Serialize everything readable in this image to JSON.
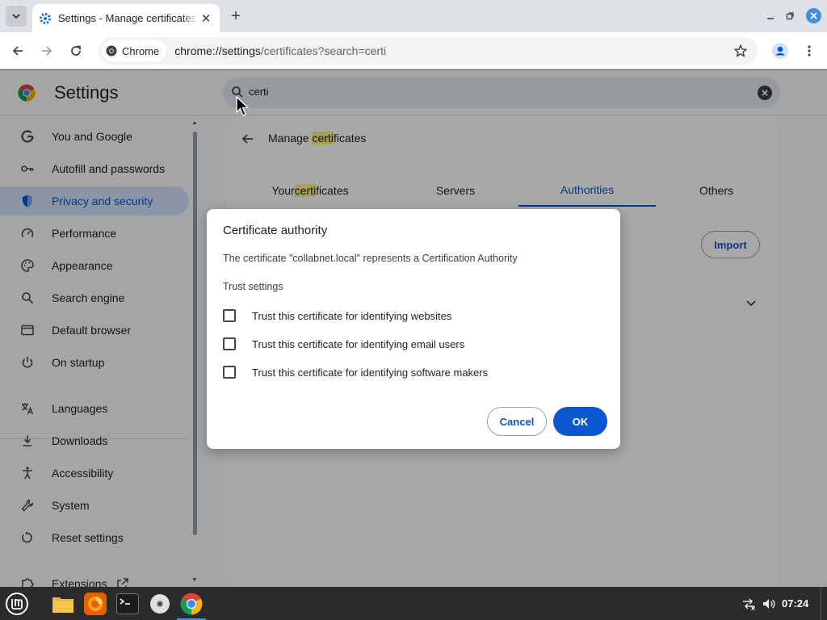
{
  "browser": {
    "tab_title": "Settings - Manage certificates",
    "new_tab_symbol": "+",
    "tab_close_symbol": "✕",
    "chip_label": "Chrome",
    "url_host": "chrome://settings",
    "url_path": "/certificates?search=certi"
  },
  "settings": {
    "title": "Settings",
    "search_value": "certi",
    "nav": [
      {
        "label": "You and Google",
        "icon": "google-g-icon"
      },
      {
        "label": "Autofill and passwords",
        "icon": "key-icon"
      },
      {
        "label": "Privacy and security",
        "icon": "shield-icon",
        "active": true
      },
      {
        "label": "Performance",
        "icon": "speedometer-icon"
      },
      {
        "label": "Appearance",
        "icon": "palette-icon"
      },
      {
        "label": "Search engine",
        "icon": "search-icon"
      },
      {
        "label": "Default browser",
        "icon": "browser-window-icon"
      },
      {
        "label": "On startup",
        "icon": "power-icon"
      },
      {
        "label": "Languages",
        "icon": "translate-icon"
      },
      {
        "label": "Downloads",
        "icon": "download-icon"
      },
      {
        "label": "Accessibility",
        "icon": "accessibility-icon"
      },
      {
        "label": "System",
        "icon": "wrench-icon"
      },
      {
        "label": "Reset settings",
        "icon": "reset-icon"
      },
      {
        "label": "Extensions",
        "icon": "puzzle-icon"
      }
    ]
  },
  "panel": {
    "title_prefix": "Manage ",
    "title_match": "certi",
    "title_suffix": "ficates",
    "tabs": [
      {
        "prefix": "Your ",
        "match": "certi",
        "suffix": "ficates"
      },
      {
        "prefix": "Servers",
        "match": "",
        "suffix": ""
      },
      {
        "prefix": "Authorities",
        "match": "",
        "suffix": "",
        "active": true
      },
      {
        "prefix": "Others",
        "match": "",
        "suffix": ""
      }
    ],
    "import_label": "Import"
  },
  "dialog": {
    "title": "Certificate authority",
    "description": "The certificate \"collabnet.local\" represents a Certification Authority",
    "subtitle": "Trust settings",
    "options": [
      {
        "label": "Trust this certificate for identifying websites",
        "checked": false
      },
      {
        "label": "Trust this certificate for identifying email users",
        "checked": false
      },
      {
        "label": "Trust this certificate for identifying software makers",
        "checked": false
      }
    ],
    "cancel_label": "Cancel",
    "ok_label": "OK"
  },
  "taskbar": {
    "clock": "07:24",
    "apps": [
      "files-icon",
      "firefox-icon",
      "terminal-icon",
      "disc-icon",
      "chrome-icon"
    ]
  },
  "colors": {
    "accent": "#0b57d0",
    "active_nav_bg": "#d3e3fd",
    "highlight": "#fef08a",
    "taskbar": "#2b2b2b"
  }
}
